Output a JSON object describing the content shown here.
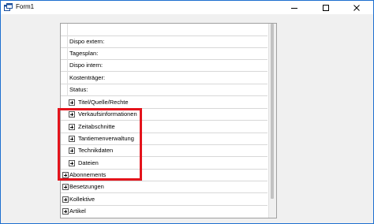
{
  "window": {
    "title": "Form1"
  },
  "grid": {
    "top_rows": [
      {
        "label": "Dispo extern:"
      },
      {
        "label": "Tagesplan:"
      },
      {
        "label": "Dispo intern:"
      },
      {
        "label": "Kostenträger:"
      },
      {
        "label": "Status:"
      }
    ],
    "highlighted_groups": [
      {
        "label": "Titel/Quelle/Rechte"
      },
      {
        "label": "Verkaufsinformationen"
      },
      {
        "label": "Zeitabschnitte"
      },
      {
        "label": "Tantiemenverwaltung"
      },
      {
        "label": "Technikdaten"
      },
      {
        "label": "Dateien"
      }
    ],
    "top_groups": [
      {
        "label": "Abonnements"
      },
      {
        "label": "Besetzungen"
      },
      {
        "label": "Kollektive"
      },
      {
        "label": "Artikel"
      }
    ]
  },
  "colors": {
    "highlight_border": "#e4141c",
    "window_border": "#1e6fd0"
  }
}
